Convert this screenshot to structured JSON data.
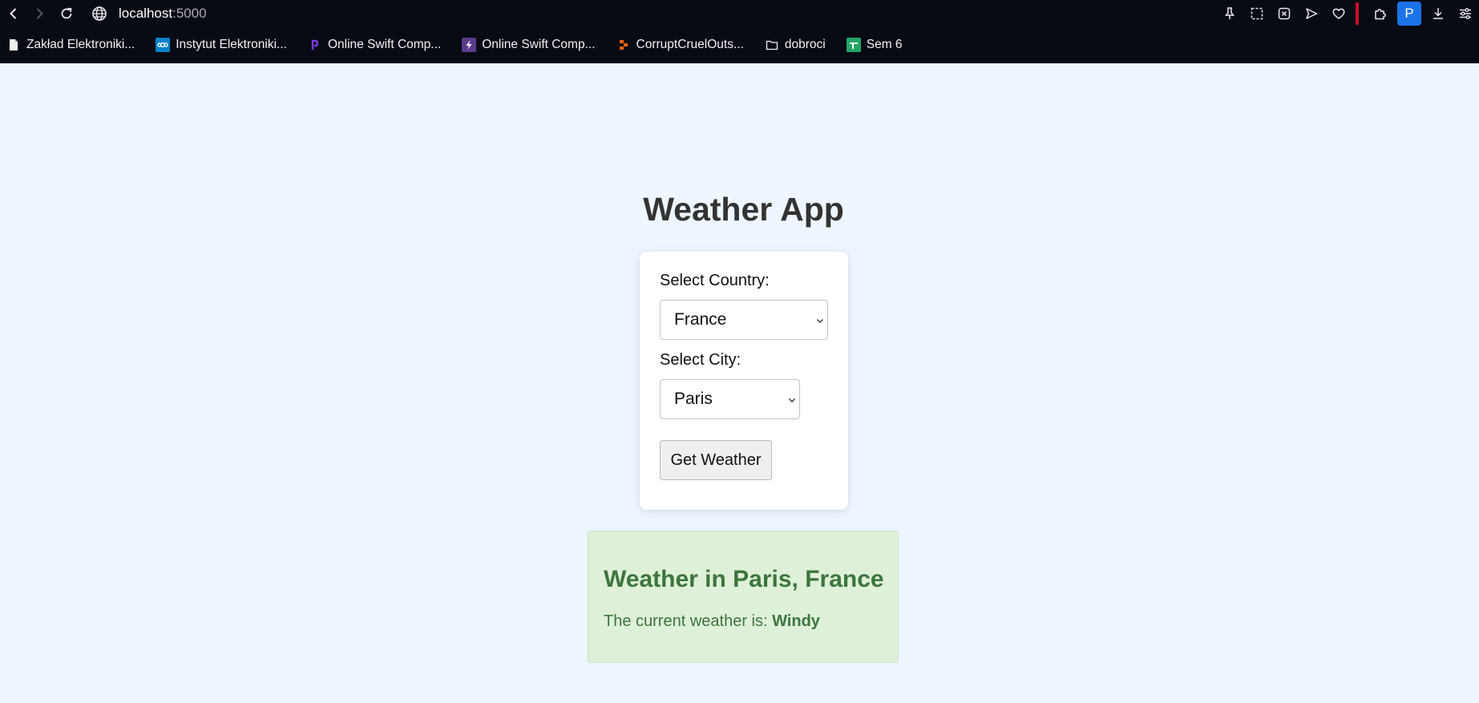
{
  "browser": {
    "url_host": "localhost",
    "url_port": ":5000",
    "profile_initial": "P",
    "bookmarks": [
      {
        "label": "Zakład Elektroniki...",
        "icon": "document-icon"
      },
      {
        "label": "Instytut Elektroniki...",
        "icon": "nextcloud-icon"
      },
      {
        "label": "Online Swift Comp...",
        "icon": "swift-icon"
      },
      {
        "label": "Online Swift Comp...",
        "icon": "bolt-icon"
      },
      {
        "label": "CorruptCruelOuts...",
        "icon": "replit-icon"
      },
      {
        "label": "dobroci",
        "icon": "folder-icon"
      },
      {
        "label": "Sem 6",
        "icon": "sheets-icon"
      }
    ]
  },
  "page": {
    "title": "Weather App",
    "country_label": "Select Country:",
    "country_value": "France",
    "city_label": "Select City:",
    "city_value": "Paris",
    "button_label": "Get Weather",
    "result_heading": "Weather in Paris, France",
    "result_prefix": "The current weather is: ",
    "result_value": "Windy"
  },
  "colors": {
    "page_bg": "#eef6ff",
    "result_bg": "#dff0d8",
    "result_text": "#3c763d",
    "chrome_bg": "#090b14"
  }
}
